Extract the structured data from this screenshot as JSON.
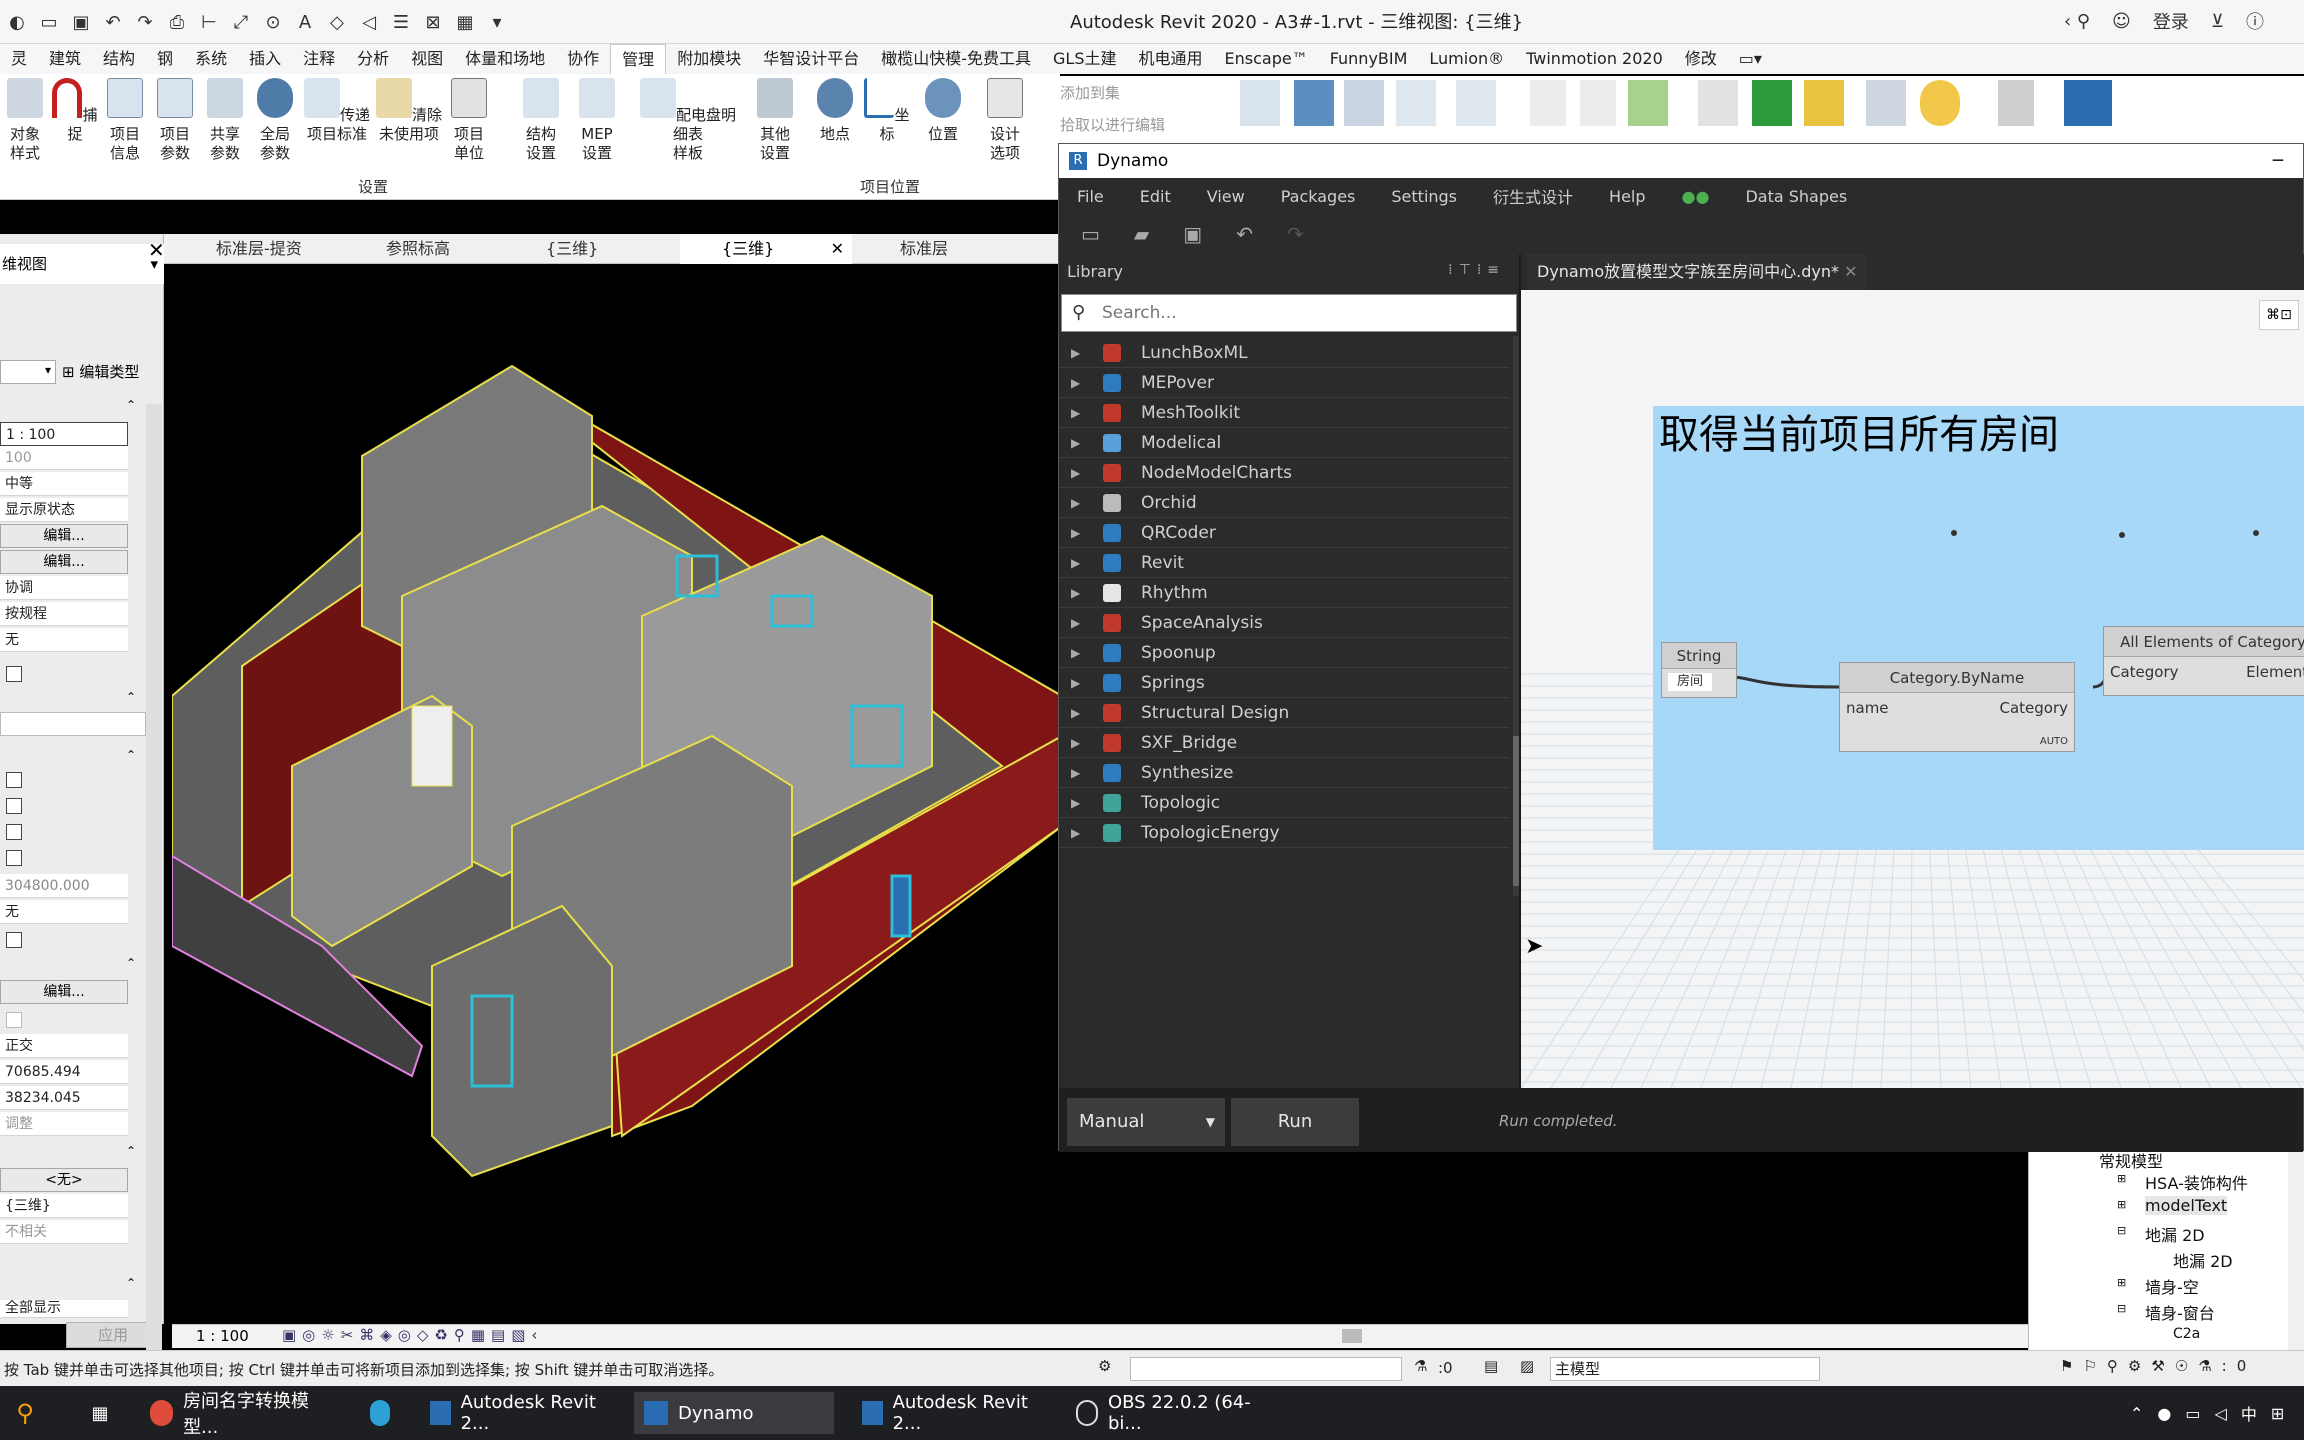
{
  "revit": {
    "title": "Autodesk Revit 2020 - A3#-1.rvt - 三维视图: {三维}",
    "login": "登录",
    "menu_tabs": [
      "灵",
      "建筑",
      "结构",
      "钢",
      "系统",
      "插入",
      "注释",
      "分析",
      "视图",
      "体量和场地",
      "协作",
      "管理",
      "附加模块",
      "华智设计平台",
      "橄榄山快模-免费工具",
      "GLS土建",
      "机电通用",
      "Enscape™",
      "FunnyBIM",
      "Lumion®",
      "Twinmotion 2020",
      "修改"
    ],
    "active_tab": "管理",
    "ribbon": {
      "buttons": [
        "对象\n样式",
        "捕捉",
        "项目\n信息",
        "项目\n参数",
        "共享\n参数",
        "全局\n参数",
        "传递\n项目标准",
        "清除\n未使用项",
        "项目\n单位",
        "结构\n设置",
        "MEP\n设置",
        "配电盘明细表\n样板",
        "其他\n设置",
        "地点",
        "坐标",
        "位置",
        "设计\n选项"
      ],
      "group_settings": "设置",
      "group_location": "项目位置",
      "add_to_set": "添加到集",
      "pick_to_edit": "拾取以进行编辑"
    },
    "view_tabs": [
      "标准层-提资",
      "参照标高",
      "{三维}",
      "{三维}",
      "标准层"
    ],
    "props": {
      "view_type": "维视图",
      "edit_type": "编辑类型",
      "scale": "1 : 100",
      "scale_value": "100",
      "detail": "中等",
      "display": "显示原状态",
      "edit1": "编辑...",
      "edit2": "编辑...",
      "discipline": "协调",
      "show_hidden": "按规程",
      "none1": "无",
      "offset": "304800.000",
      "none2": "无",
      "edit3": "编辑...",
      "projection": "正交",
      "eye_elev": "70685.494",
      "target_elev": "38234.045",
      "adjust": "调整",
      "none3": "<无>",
      "view_name": "{三维}",
      "dependency": "不相关",
      "show_all": "全部显示",
      "apply": "应用"
    },
    "viewbar_scale": "1 : 100",
    "status_text": "按 Tab 键并单击可选择其他项目; 按 Ctrl 键并单击可将新项目添加到选择集; 按 Shift 键并单击可取消选择。",
    "status_zero": ":0",
    "status_model": "主模型",
    "browser": {
      "root": "常规模型",
      "items": [
        "HSA-装饰构件",
        "modelText",
        "地漏 2D",
        "地漏 2D",
        "墙身-空",
        "墙身-窗台",
        "C2a"
      ]
    }
  },
  "dynamo": {
    "title": "Dynamo",
    "menu": [
      "File",
      "Edit",
      "View",
      "Packages",
      "Settings",
      "衍生式设计",
      "Help",
      "Data Shapes"
    ],
    "library_title": "Library",
    "search_placeholder": "Search...",
    "packages": [
      "LunchBoxML",
      "MEPover",
      "MeshToolkit",
      "Modelical",
      "NodeModelCharts",
      "Orchid",
      "QRCoder",
      "Revit",
      "Rhythm",
      "SpaceAnalysis",
      "Spoonup",
      "Springs",
      "Structural Design",
      "SXF_Bridge",
      "Synthesize",
      "Topologic",
      "TopologicEnergy"
    ],
    "workspace_tab": "Dynamo放置模型文字族至房间中心.dyn*",
    "group_title": "取得当前项目所有房间",
    "nodes": {
      "string": {
        "title": "String",
        "value": "房间"
      },
      "category": {
        "title": "Category.ByName",
        "in": "name",
        "out": "Category",
        "lacing": "AUTO"
      },
      "elements": {
        "title": "All Elements of Category",
        "in": "Category",
        "out": "Elements"
      }
    },
    "run_mode": "Manual",
    "run_label": "Run",
    "run_status": "Run completed."
  },
  "taskbar": {
    "items": [
      "房间名字转换模型...",
      "Autodesk Revit 2...",
      "Dynamo",
      "Autodesk Revit 2...",
      "OBS 22.0.2 (64-bi..."
    ],
    "tray": "中"
  },
  "colors": {
    "group": "#a8d8f7",
    "wall_red": "#8b1a1a",
    "outline_yellow": "#e8e04a",
    "glass_cyan": "#2bc0d8"
  }
}
